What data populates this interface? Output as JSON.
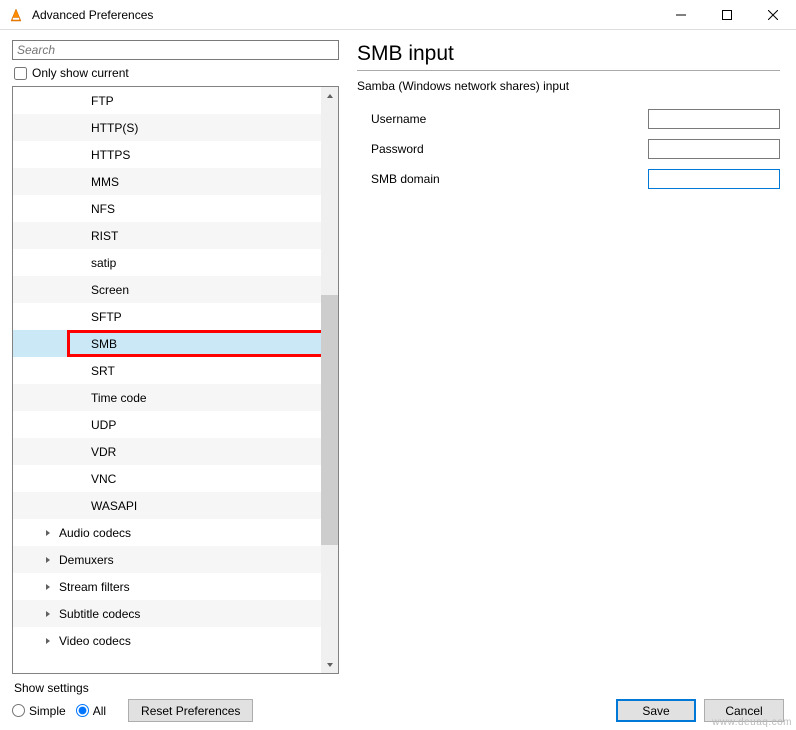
{
  "window": {
    "title": "Advanced Preferences"
  },
  "search": {
    "placeholder": "Search"
  },
  "only_current_label": "Only show current",
  "tree": {
    "items": [
      {
        "label": "FTP",
        "indent": 2,
        "expandable": false
      },
      {
        "label": "HTTP(S)",
        "indent": 2,
        "expandable": false
      },
      {
        "label": "HTTPS",
        "indent": 2,
        "expandable": false
      },
      {
        "label": "MMS",
        "indent": 2,
        "expandable": false
      },
      {
        "label": "NFS",
        "indent": 2,
        "expandable": false
      },
      {
        "label": "RIST",
        "indent": 2,
        "expandable": false
      },
      {
        "label": "satip",
        "indent": 2,
        "expandable": false
      },
      {
        "label": "Screen",
        "indent": 2,
        "expandable": false
      },
      {
        "label": "SFTP",
        "indent": 2,
        "expandable": false
      },
      {
        "label": "SMB",
        "indent": 2,
        "expandable": false,
        "selected": true,
        "highlighted": true
      },
      {
        "label": "SRT",
        "indent": 2,
        "expandable": false
      },
      {
        "label": "Time code",
        "indent": 2,
        "expandable": false
      },
      {
        "label": "UDP",
        "indent": 2,
        "expandable": false
      },
      {
        "label": "VDR",
        "indent": 2,
        "expandable": false
      },
      {
        "label": "VNC",
        "indent": 2,
        "expandable": false
      },
      {
        "label": "WASAPI",
        "indent": 2,
        "expandable": false
      },
      {
        "label": "Audio codecs",
        "indent": 1,
        "expandable": true
      },
      {
        "label": "Demuxers",
        "indent": 1,
        "expandable": true
      },
      {
        "label": "Stream filters",
        "indent": 1,
        "expandable": true
      },
      {
        "label": "Subtitle codecs",
        "indent": 1,
        "expandable": true
      },
      {
        "label": "Video codecs",
        "indent": 1,
        "expandable": true
      }
    ]
  },
  "right": {
    "title": "SMB input",
    "description": "Samba (Windows network shares) input",
    "fields": [
      {
        "label": "Username",
        "value": "",
        "focused": false
      },
      {
        "label": "Password",
        "value": "",
        "focused": false
      },
      {
        "label": "SMB domain",
        "value": "",
        "focused": true
      }
    ]
  },
  "footer": {
    "show_settings_label": "Show settings",
    "radio_simple": "Simple",
    "radio_all": "All",
    "reset_label": "Reset Preferences",
    "save_label": "Save",
    "cancel_label": "Cancel"
  },
  "watermark": "www.deuaq.com"
}
